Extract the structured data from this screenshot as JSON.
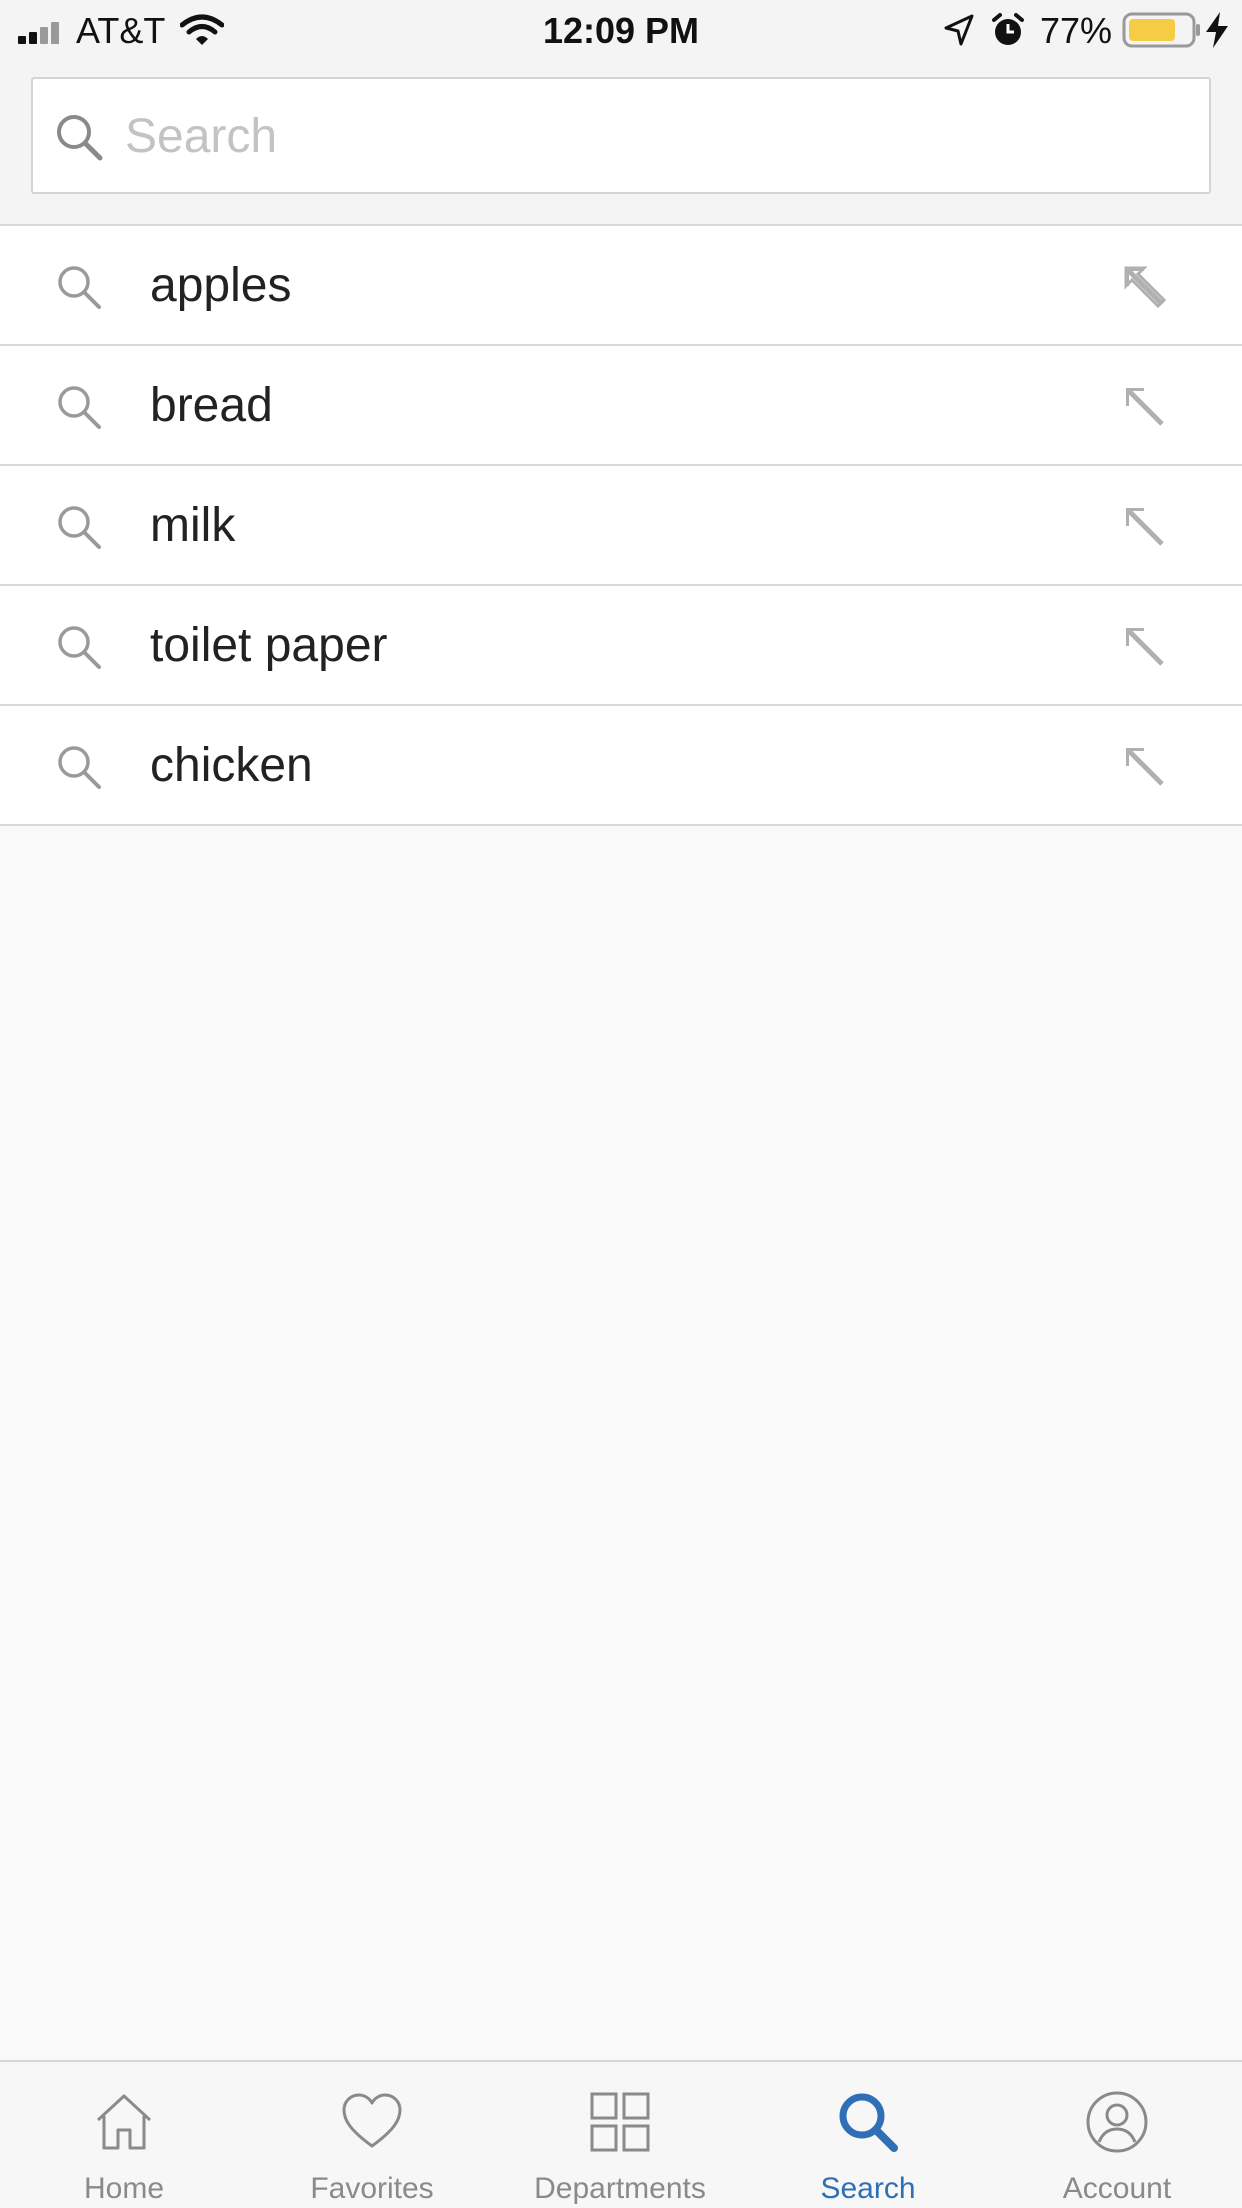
{
  "status_bar": {
    "carrier": "AT&T",
    "time": "12:09 PM",
    "battery_percent": "77%",
    "battery_level": 0.77,
    "battery_color": "#f6cc45"
  },
  "search": {
    "placeholder": "Search",
    "value": "",
    "icon": "search-icon"
  },
  "suggestions": [
    {
      "label": "apples",
      "icon": "search-icon",
      "action_icon": "arrow-up-left-icon"
    },
    {
      "label": "bread",
      "icon": "search-icon",
      "action_icon": "arrow-up-left-icon"
    },
    {
      "label": "milk",
      "icon": "search-icon",
      "action_icon": "arrow-up-left-icon"
    },
    {
      "label": "toilet paper",
      "icon": "search-icon",
      "action_icon": "arrow-up-left-icon"
    },
    {
      "label": "chicken",
      "icon": "search-icon",
      "action_icon": "arrow-up-left-icon"
    }
  ],
  "tab_bar": {
    "active_color": "#2f6fb5",
    "inactive_color": "#8a8a8a",
    "tabs": [
      {
        "label": "Home",
        "icon": "home-icon",
        "active": false
      },
      {
        "label": "Favorites",
        "icon": "heart-icon",
        "active": false
      },
      {
        "label": "Departments",
        "icon": "grid-icon",
        "active": false
      },
      {
        "label": "Search",
        "icon": "search-icon",
        "active": true
      },
      {
        "label": "Account",
        "icon": "account-icon",
        "active": false
      }
    ]
  }
}
